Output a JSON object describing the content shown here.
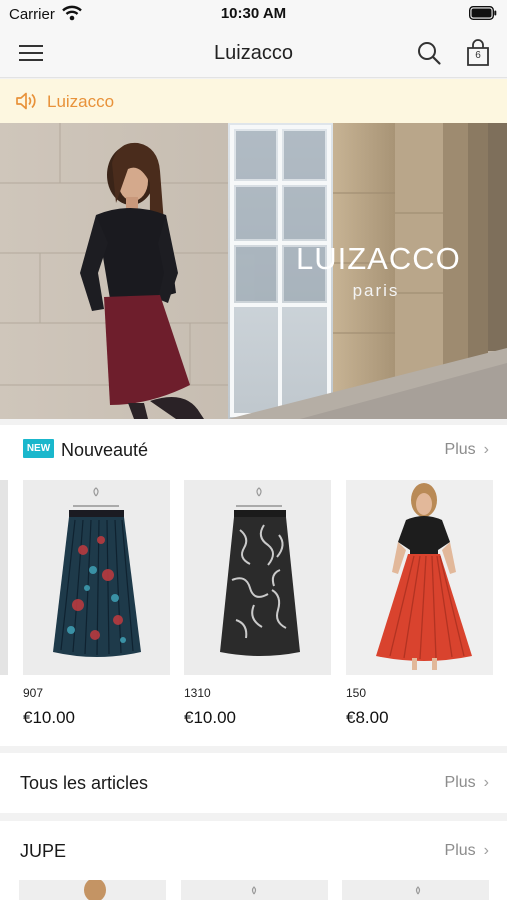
{
  "status_bar": {
    "carrier": "Carrier",
    "time": "10:30 AM"
  },
  "nav": {
    "title": "Luizacco",
    "cart_count": "6"
  },
  "notice": {
    "text": "Luizacco"
  },
  "hero": {
    "brand": "LUIZACCO",
    "subtitle": "paris"
  },
  "new_section": {
    "badge": "NEW",
    "title": "Nouveauté",
    "more": "Plus",
    "products": [
      {
        "code": "907",
        "price": "€10.00"
      },
      {
        "code": "1310",
        "price": "€10.00"
      },
      {
        "code": "150",
        "price": "€8.00"
      }
    ]
  },
  "all_section": {
    "title": "Tous les articles",
    "more": "Plus"
  },
  "jupe_section": {
    "title": "JUPE",
    "more": "Plus"
  },
  "colors": {
    "accent": "#1ab7cc",
    "notice_text": "#e8923a",
    "notice_bg": "#fdf7e0",
    "skirt_red": "#d9432e",
    "skirt_burgundy": "#6e1e2c"
  },
  "icons": [
    "wifi-icon",
    "battery-icon",
    "menu-icon",
    "search-icon",
    "shopping-bag-icon",
    "speaker-icon",
    "chevron-right-icon"
  ]
}
